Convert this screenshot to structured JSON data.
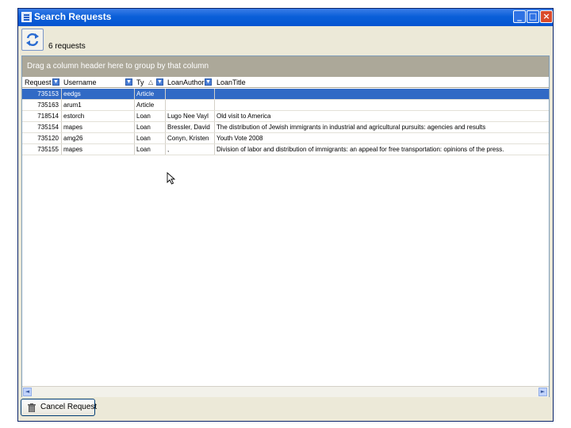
{
  "window": {
    "title": "Search Requests",
    "buttons": {
      "minimize": "_",
      "maximize": "□",
      "close": "×"
    }
  },
  "toolbar": {
    "refresh_icon": "refresh-icon",
    "request_count": "6 requests"
  },
  "grid": {
    "group_panel_text": "Drag a column header here to group by that column",
    "columns": [
      {
        "label": "Request",
        "icon": "filter-dropdown-icon"
      },
      {
        "label": "Username",
        "icon": "filter-dropdown-icon"
      },
      {
        "label": "Ty",
        "sort": "ascending",
        "icon": "filter-dropdown-icon"
      },
      {
        "label": "LoanAuthor",
        "icon": "filter-dropdown-icon"
      },
      {
        "label": "LoanTitle"
      }
    ],
    "rows": [
      {
        "request": "735153",
        "username": "eedgs",
        "type": "Article",
        "author": "",
        "title": "",
        "selected": true
      },
      {
        "request": "735163",
        "username": "arum1",
        "type": "Article",
        "author": "",
        "title": ""
      },
      {
        "request": "718514",
        "username": "estorch",
        "type": "Loan",
        "author": "Lugo Nee Vayl",
        "title": "Old visit to America"
      },
      {
        "request": "735154",
        "username": "mapes",
        "type": "Loan",
        "author": "Bressler, David",
        "title": "The distribution of Jewish immigrants in industrial and agricultural pursuits: agencies and results"
      },
      {
        "request": "735120",
        "username": "amg26",
        "type": "Loan",
        "author": "Conyn, Kristen",
        "title": "Youth Vote 2008"
      },
      {
        "request": "735155",
        "username": "mapes",
        "type": "Loan",
        "author": ",",
        "title": "Division of labor and distribution of immigrants: an appeal for free transportation: opinions of the press."
      }
    ],
    "scroll": {
      "left": "◄",
      "right": "►"
    }
  },
  "footer": {
    "cancel_label": "Cancel Request",
    "cancel_icon": "trash-icon"
  },
  "colors": {
    "title_bar": "#0554d0",
    "selection": "#316ac5",
    "group_panel": "#aca899",
    "window_bg": "#ece9d8"
  }
}
